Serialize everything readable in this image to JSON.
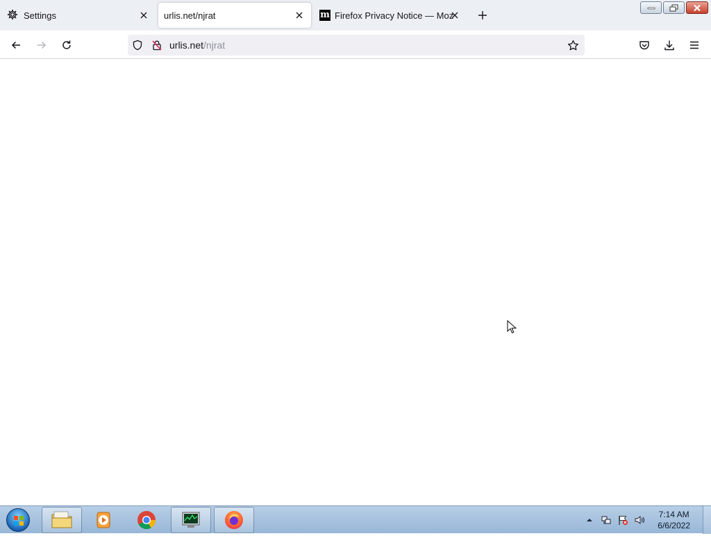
{
  "browser": {
    "tabs": [
      {
        "label": "Settings",
        "icon": "gear-icon"
      },
      {
        "label": "urlis.net/njrat",
        "active": true
      },
      {
        "label": "Firefox Privacy Notice — Mozilla",
        "icon": "mozilla-m-icon"
      }
    ],
    "address": {
      "domain": "urlis.net",
      "path": "/njrat"
    }
  },
  "taskbar": {
    "apps": [
      "file-explorer",
      "media-player",
      "chrome",
      "task-manager",
      "firefox"
    ],
    "clock": {
      "time": "7:14 AM",
      "date": "6/6/2022"
    }
  },
  "colors": {
    "tabbar_bg": "#eceff3",
    "url_bg": "#f0f0f4",
    "taskbar_bg": "#a8c3e0"
  }
}
